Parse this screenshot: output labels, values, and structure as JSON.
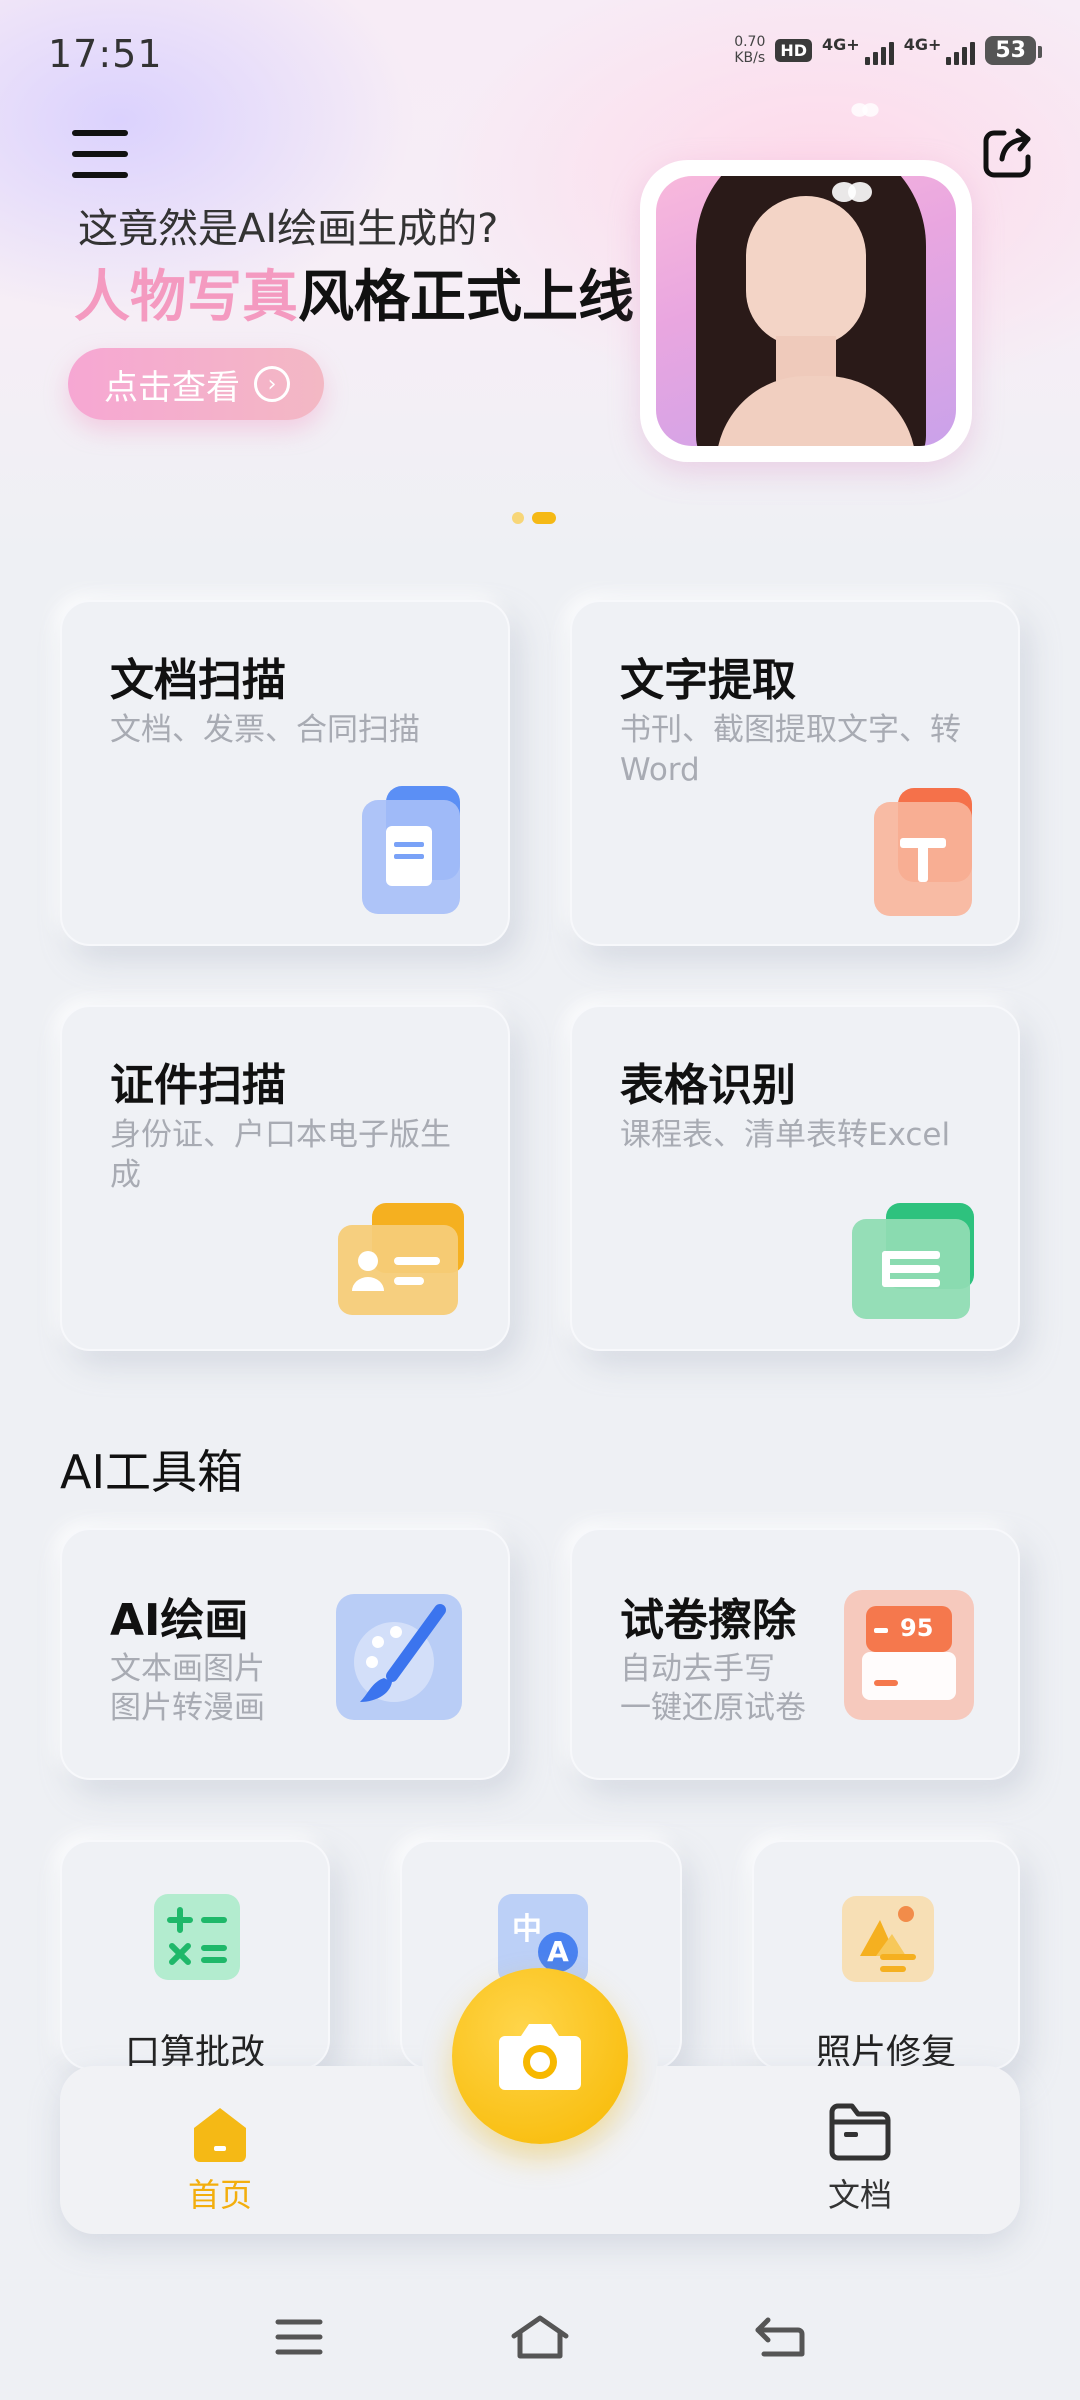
{
  "status_bar": {
    "time": "17:51",
    "net_speed_value": "0.70",
    "net_speed_unit": "KB/s",
    "hd_label": "HD",
    "sim1_label": "4G+",
    "sim2_label": "4G+",
    "battery": "53"
  },
  "banner": {
    "line1": "这竟然是AI绘画生成的?",
    "line2_highlight": "人物写真",
    "line2_rest": "风格正式上线",
    "button_label": "点击查看",
    "page_count": 2,
    "active_page": 2
  },
  "features": [
    {
      "title": "文档扫描",
      "subtitle": "文档、发票、合同扫描",
      "icon": "document-scan-icon",
      "color": "#5b8ff5"
    },
    {
      "title": "文字提取",
      "subtitle": "书刊、截图提取文字、转Word",
      "icon": "text-extract-icon",
      "color": "#f5714a"
    },
    {
      "title": "证件扫描",
      "subtitle": "身份证、户口本电子版生成",
      "icon": "id-card-icon",
      "color": "#f5b020"
    },
    {
      "title": "表格识别",
      "subtitle": "课程表、清单表转Excel",
      "icon": "table-recognize-icon",
      "color": "#2ec27e"
    }
  ],
  "ai_toolbox": {
    "section_title": "AI工具箱",
    "cards": [
      {
        "title": "AI绘画",
        "line1": "文本画图片",
        "line2": "图片转漫画",
        "icon": "paint-brush-icon"
      },
      {
        "title": "试卷擦除",
        "line1": "自动去手写",
        "line2": "一键还原试卷",
        "icon": "exam-erase-icon",
        "badge": "95"
      }
    ],
    "small_tools": [
      {
        "label": "口算批改",
        "icon": "math-check-icon"
      },
      {
        "label": "",
        "icon": "translate-icon",
        "glyph1": "中",
        "glyph2": "A"
      },
      {
        "label": "照片修复",
        "icon": "photo-restore-icon"
      }
    ]
  },
  "bottom_nav": {
    "home_label": "首页",
    "docs_label": "文档"
  },
  "colors": {
    "accent_yellow": "#f5b915",
    "banner_pink": "#f49ac0"
  }
}
